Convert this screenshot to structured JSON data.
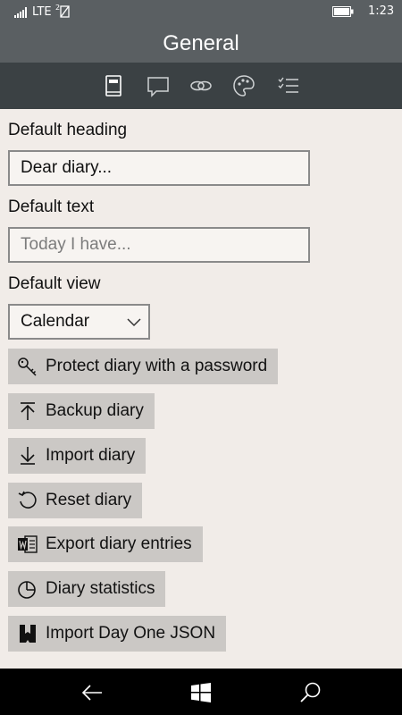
{
  "status": {
    "network": "LTE",
    "time": "1:23"
  },
  "header": {
    "title": "General"
  },
  "tabs": [
    {
      "icon": "book-icon"
    },
    {
      "icon": "speech-bubble-icon"
    },
    {
      "icon": "link-icon"
    },
    {
      "icon": "palette-icon"
    },
    {
      "icon": "checklist-icon"
    }
  ],
  "form": {
    "default_heading_label": "Default heading",
    "default_heading_value": "Dear diary...",
    "default_text_label": "Default text",
    "default_text_placeholder": "Today I have...",
    "default_view_label": "Default view",
    "default_view_value": "Calendar"
  },
  "actions": {
    "protect": "Protect diary with a password",
    "backup": "Backup diary",
    "import": "Import diary",
    "reset": "Reset diary",
    "export": "Export diary entries",
    "statistics": "Diary statistics",
    "dayone": "Import Day One JSON"
  },
  "colors": {
    "header_bg": "#5a5f62",
    "tabbar_bg": "#3b4144",
    "page_bg": "#f1ece8",
    "button_bg": "#cbc8c5"
  }
}
